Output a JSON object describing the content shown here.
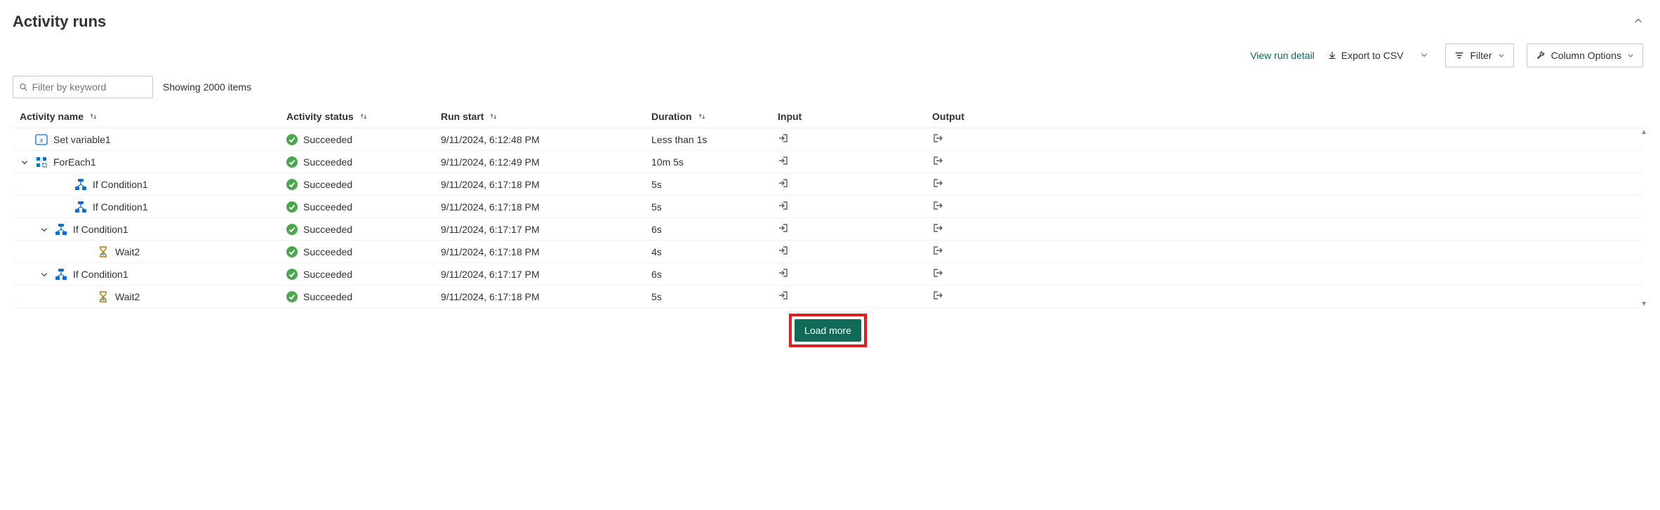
{
  "header": {
    "title": "Activity runs"
  },
  "toolbar": {
    "view_run_detail": "View run detail",
    "export_csv": "Export to CSV",
    "filter": "Filter",
    "column_options": "Column Options"
  },
  "filterbar": {
    "placeholder": "Filter by keyword",
    "items_shown": "Showing 2000 items"
  },
  "columns": {
    "name": "Activity name",
    "status": "Activity status",
    "start": "Run start",
    "duration": "Duration",
    "input": "Input",
    "output": "Output"
  },
  "rows": [
    {
      "indent": 0,
      "chevron": "",
      "icon": "var",
      "name": "Set variable1",
      "status": "Succeeded",
      "start": "9/11/2024, 6:12:48 PM",
      "duration": "Less than 1s"
    },
    {
      "indent": 0,
      "chevron": "down",
      "icon": "each",
      "name": "ForEach1",
      "status": "Succeeded",
      "start": "9/11/2024, 6:12:49 PM",
      "duration": "10m 5s"
    },
    {
      "indent": 2,
      "chevron": "",
      "icon": "cond",
      "name": "If Condition1",
      "status": "Succeeded",
      "start": "9/11/2024, 6:17:18 PM",
      "duration": "5s"
    },
    {
      "indent": 2,
      "chevron": "",
      "icon": "cond",
      "name": "If Condition1",
      "status": "Succeeded",
      "start": "9/11/2024, 6:17:18 PM",
      "duration": "5s"
    },
    {
      "indent": 1,
      "chevron": "down",
      "icon": "cond",
      "name": "If Condition1",
      "status": "Succeeded",
      "start": "9/11/2024, 6:17:17 PM",
      "duration": "6s"
    },
    {
      "indent": 3,
      "chevron": "",
      "icon": "wait",
      "name": "Wait2",
      "status": "Succeeded",
      "start": "9/11/2024, 6:17:18 PM",
      "duration": "4s"
    },
    {
      "indent": 1,
      "chevron": "down",
      "icon": "cond",
      "name": "If Condition1",
      "status": "Succeeded",
      "start": "9/11/2024, 6:17:17 PM",
      "duration": "6s"
    },
    {
      "indent": 3,
      "chevron": "",
      "icon": "wait",
      "name": "Wait2",
      "status": "Succeeded",
      "start": "9/11/2024, 6:17:18 PM",
      "duration": "5s"
    }
  ],
  "load_more": "Load more"
}
